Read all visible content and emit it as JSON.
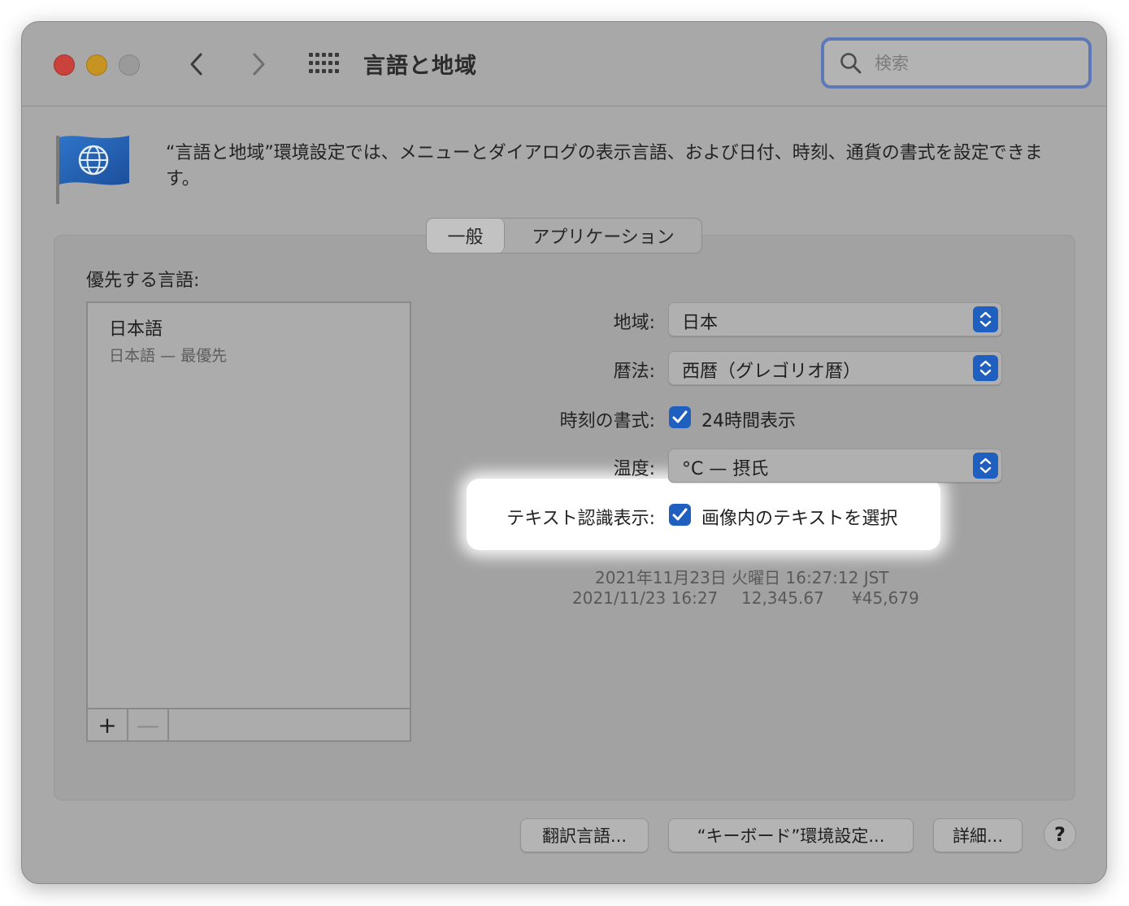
{
  "window": {
    "title": "言語と地域",
    "search_placeholder": "検索"
  },
  "icons": {
    "back": "chevron-left-icon",
    "forward": "chevron-right-icon",
    "grid": "grid-icon",
    "search": "search-icon",
    "flag": "globe-flag-icon"
  },
  "header": {
    "description": "“言語と地域”環境設定では、メニューとダイアログの表示言語、および日付、時刻、通貨の書式を設定できます。"
  },
  "tabs": [
    {
      "label": "一般",
      "active": true
    },
    {
      "label": "アプリケーション",
      "active": false
    }
  ],
  "languages": {
    "label": "優先する言語:",
    "items": [
      {
        "name": "日本語",
        "sub": "日本語 — 最優先"
      }
    ],
    "add_label": "+",
    "remove_label": "—"
  },
  "settings": {
    "region_label": "地域:",
    "region_value": "日本",
    "calendar_label": "暦法:",
    "calendar_value": "西暦（グレゴリオ暦）",
    "time_format_label": "時刻の書式:",
    "time_format_check": "24時間表示",
    "time_format_checked": true,
    "temperature_label": "温度:",
    "temperature_value": "°C — 摂氏",
    "live_text_label": "テキスト認識表示:",
    "live_text_check": "画像内のテキストを選択",
    "live_text_checked": true
  },
  "sample": {
    "line1": "2021年11月23日 火曜日 16:27:12 JST",
    "date_short": "2021/11/23 16:27",
    "number": "12,345.67",
    "currency": "¥45,679"
  },
  "buttons": {
    "translation": "翻訳言語...",
    "keyboard": "“キーボード”環境設定...",
    "advanced": "詳細...",
    "help": "?"
  },
  "colors": {
    "accent": "#1f5fbf",
    "close": "#c9423b",
    "minimize": "#c79424",
    "zoom_disabled": "#9a9a9a"
  }
}
